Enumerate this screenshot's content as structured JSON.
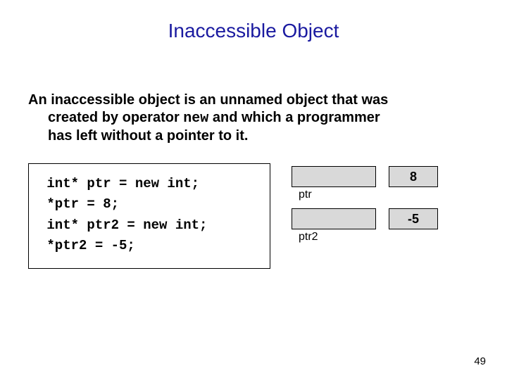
{
  "title": "Inaccessible Object",
  "paragraph": {
    "line1": "An inaccessible object is an unnamed object that was",
    "line2_a": "created by operator ",
    "line2_code": "new",
    "line2_b": " and which a programmer",
    "line3": "has left without a pointer to it."
  },
  "code": " int* ptr = new int;\n *ptr = 8;\n int* ptr2 = new int;\n *ptr2 = -5;",
  "diagram": {
    "ptr_label": "ptr",
    "ptr_val": "8",
    "ptr2_label": "ptr2",
    "ptr2_val": "-5"
  },
  "page_number": "49"
}
